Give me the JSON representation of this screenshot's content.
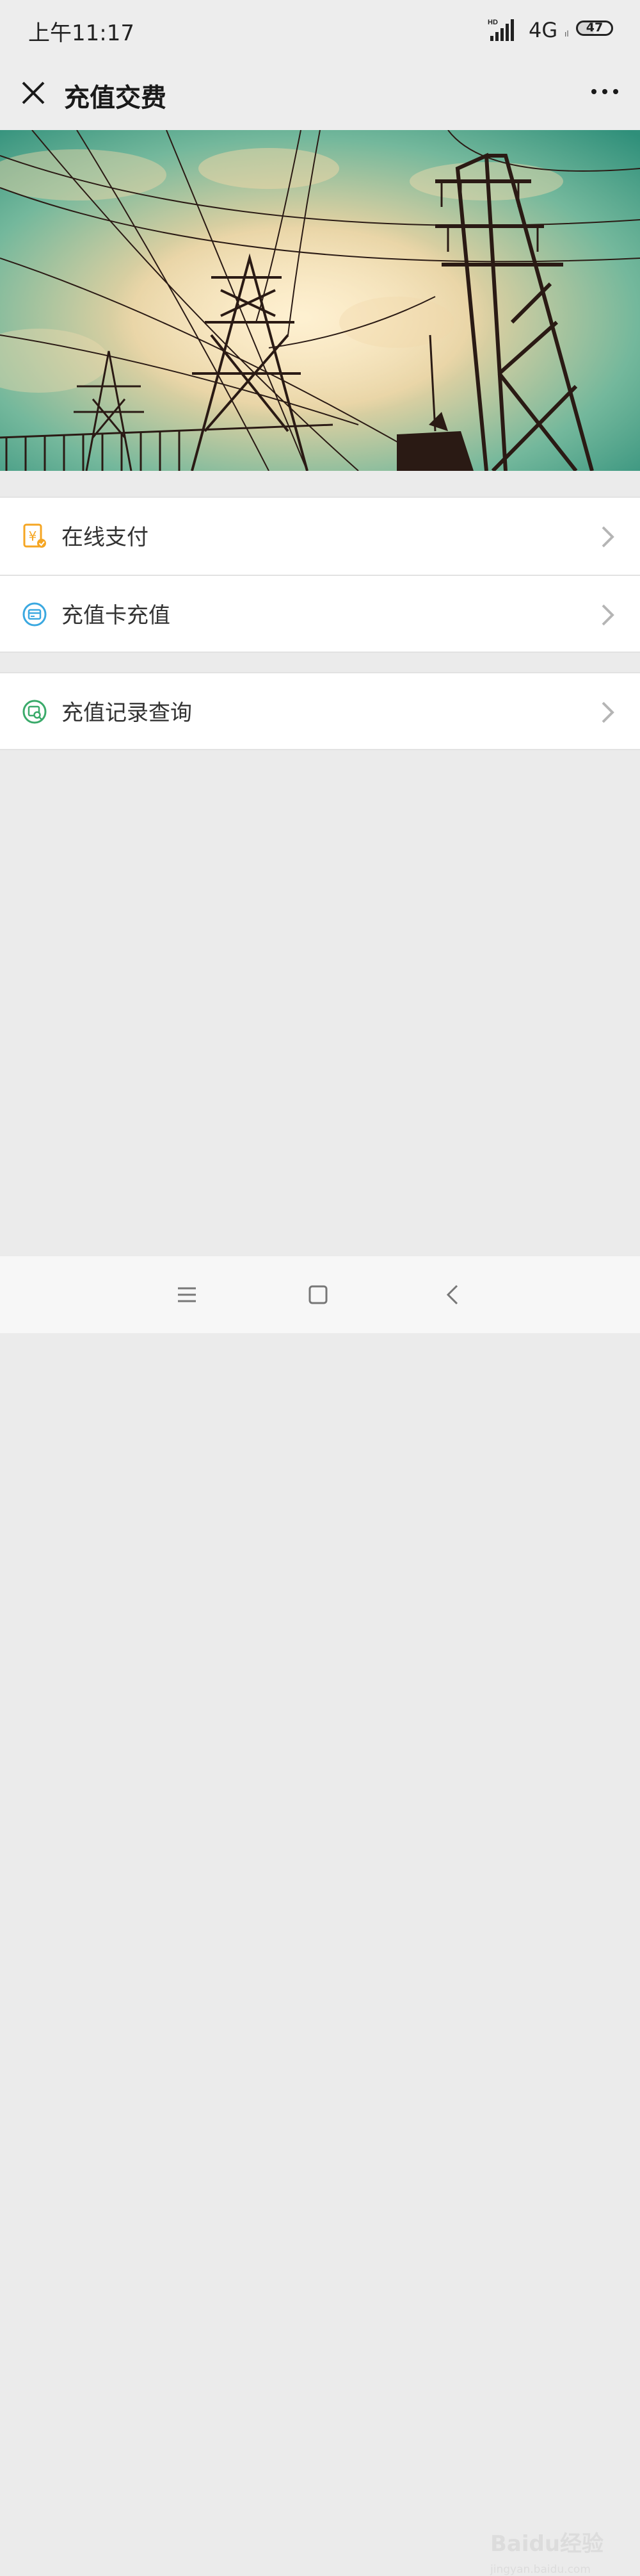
{
  "status_bar": {
    "time": "上午11:17",
    "network": "4G",
    "network_sub": "ıl",
    "battery": "47",
    "hd_label": "HD"
  },
  "app_bar": {
    "title": "充值交费",
    "close_icon": "close-icon",
    "more_icon": "more-icon"
  },
  "banner": {
    "icon": "power-lines-photo"
  },
  "menu": {
    "group_a": [
      {
        "label": "在线支付",
        "icon": "yuan-payment-icon",
        "icon_color": "#f5a623"
      },
      {
        "label": "充值卡充值",
        "icon": "card-icon",
        "icon_color": "#3aa8e0"
      }
    ],
    "group_b": [
      {
        "label": "充值记录查询",
        "icon": "record-search-icon",
        "icon_color": "#3aaa6a"
      }
    ]
  },
  "nav_bar": {
    "menu_icon": "menu-icon",
    "home_icon": "home-icon",
    "back_icon": "back-icon"
  },
  "watermark": {
    "text": "Baidu经验",
    "sub": "jingyan.baidu.com"
  },
  "colors": {
    "background": "#ebebeb",
    "header": "#ededed",
    "card": "#ffffff"
  }
}
